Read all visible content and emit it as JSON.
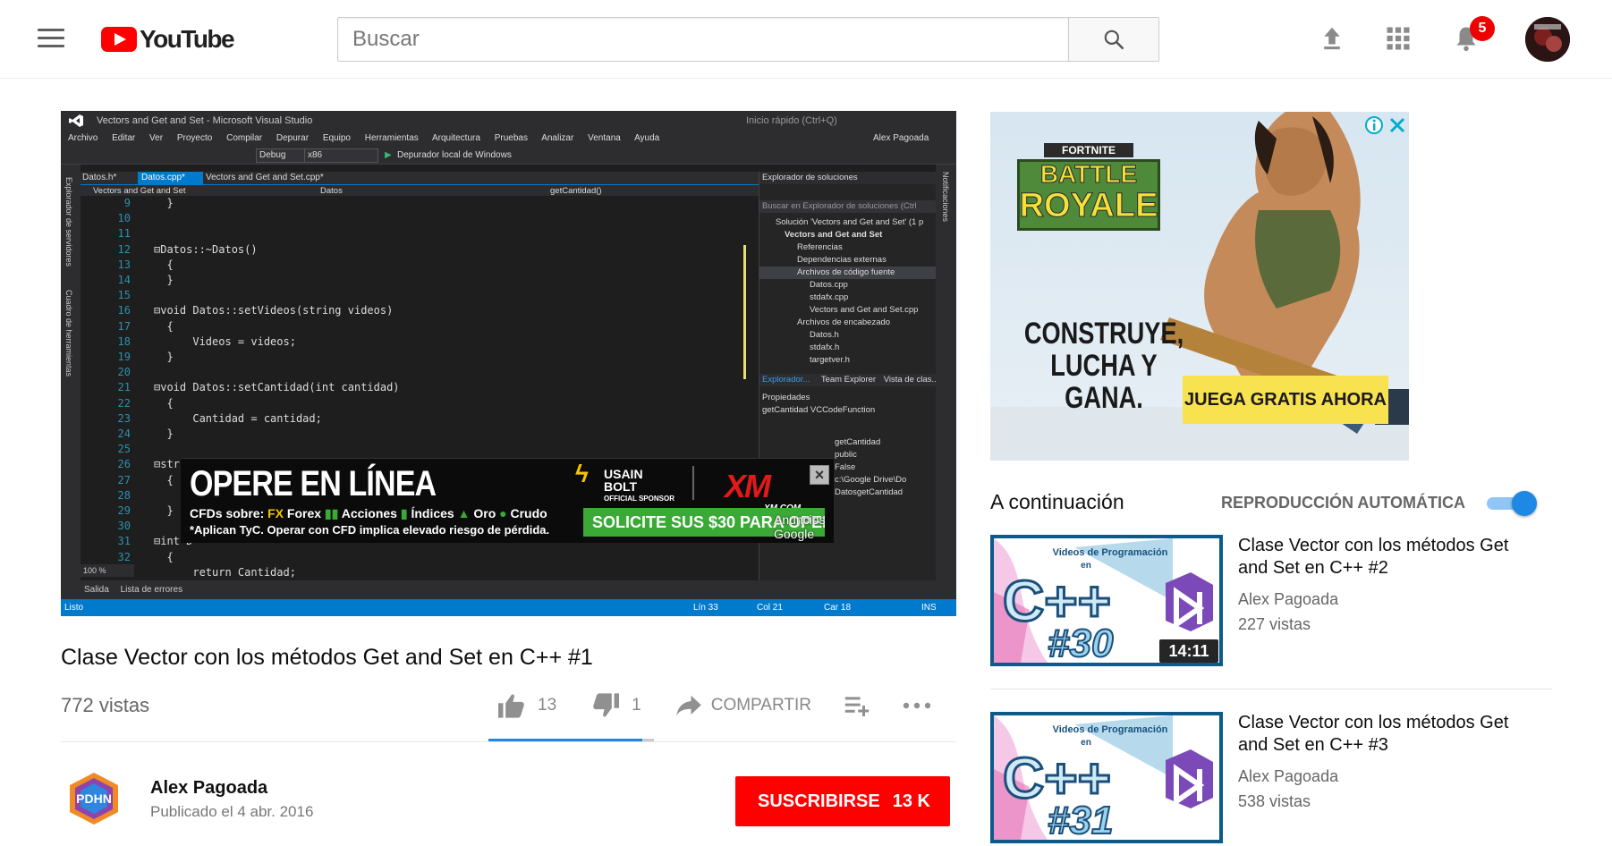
{
  "header": {
    "logo_text": "YouTube",
    "search_placeholder": "Buscar",
    "notification_count": "5"
  },
  "player": {
    "vs_title": "Vectors and Get and Set - Microsoft Visual Studio",
    "vs_menu": [
      "Archivo",
      "Editar",
      "Ver",
      "Proyecto",
      "Compilar",
      "Depurar",
      "Equipo",
      "Herramientas",
      "Arquitectura",
      "Pruebas",
      "Analizar",
      "Ventana",
      "Ayuda"
    ],
    "vs_user": "Alex Pagoada",
    "vs_quicklaunch": "Inicio rápido (Ctrl+Q)",
    "vs_config": "Debug",
    "vs_platform": "x86",
    "vs_debugger": "Depurador local de Windows",
    "vs_tabs": [
      "Datos.h*",
      "Datos.cpp*",
      "Vectors and Get and Set.cpp*"
    ],
    "vs_nav": [
      "Vectors and Get and Set",
      "Datos",
      "getCantidad()"
    ],
    "code_lines": [
      {
        "n": "9",
        "t": "  }"
      },
      {
        "n": "10",
        "t": ""
      },
      {
        "n": "11",
        "t": ""
      },
      {
        "n": "12",
        "t": "⊟Datos::~Datos()"
      },
      {
        "n": "13",
        "t": "  {"
      },
      {
        "n": "14",
        "t": "  }"
      },
      {
        "n": "15",
        "t": ""
      },
      {
        "n": "16",
        "t": "⊟void Datos::setVideos(string videos)"
      },
      {
        "n": "17",
        "t": "  {"
      },
      {
        "n": "18",
        "t": "      Videos = videos;"
      },
      {
        "n": "19",
        "t": "  }"
      },
      {
        "n": "20",
        "t": ""
      },
      {
        "n": "21",
        "t": "⊟void Datos::setCantidad(int cantidad)"
      },
      {
        "n": "22",
        "t": "  {"
      },
      {
        "n": "23",
        "t": "      Cantidad = cantidad;"
      },
      {
        "n": "24",
        "t": "  }"
      },
      {
        "n": "25",
        "t": ""
      },
      {
        "n": "26",
        "t": "⊟string Datos::getVideos()"
      },
      {
        "n": "27",
        "t": "  {"
      },
      {
        "n": "28",
        "t": "      r"
      },
      {
        "n": "29",
        "t": "  }"
      },
      {
        "n": "30",
        "t": ""
      },
      {
        "n": "31",
        "t": "⊟int D"
      },
      {
        "n": "32",
        "t": "  {"
      },
      {
        "n": "33",
        "t": "      return Cantidad;"
      }
    ],
    "vs_zoom": "100 %",
    "explorer_title": "Explorador de soluciones",
    "explorer_search": "Buscar en Explorador de soluciones (Ctrl",
    "explorer_items": [
      "Solución 'Vectors and Get and Set' (1 p",
      "Vectors and Get and Set",
      "Referencias",
      "Dependencias externas",
      "Archivos de código fuente",
      "Datos.cpp",
      "stdafx.cpp",
      "Vectors and Get and Set.cpp",
      "Archivos de encabezado",
      "Datos.h",
      "stdafx.h",
      "targetver.h"
    ],
    "explorer_tabs": [
      "Explorador...",
      "Team Explorer",
      "Vista de clas..."
    ],
    "props_title": "Propiedades",
    "props_object": "getCantidad  VCCodeFunction",
    "props_values": [
      "getCantidad",
      "public",
      "False",
      "c:\\Google Drive\\Do",
      "DatosgetCantidad"
    ],
    "vs_output_tabs": [
      "Salida",
      "Lista de errores"
    ],
    "vs_status": {
      "left": "Listo",
      "ln": "Lín 33",
      "col": "Col 21",
      "car": "Car 18",
      "mode": "INS"
    },
    "vs_side_labels": [
      "Explorador de servidores",
      "Cuadro de herramientas"
    ],
    "vs_right_label": "Notificaciones"
  },
  "overlay_ad": {
    "headline": "OPERE EN LÍNEA",
    "sub_prefix": "CFDs sobre:",
    "sub_items": [
      "FX",
      "Forex",
      "Acciones",
      "Índices",
      "Oro",
      "Crudo"
    ],
    "legal": "*Aplican TyC. Operar con CFD implica elevado riesgo de pérdida.",
    "bolt_line1": "USAIN",
    "bolt_line2": "BOLT",
    "bolt_line3": "OFFICIAL SPONSOR",
    "brand": "XM",
    "brand_url": "XM.COM",
    "cta": "SOLICITE SUS $30 PARA OPERAR",
    "google_label": "Anuncios Google"
  },
  "video": {
    "title": "Clase Vector con los métodos Get and Set en C++ #1",
    "views": "772 vistas",
    "likes": "13",
    "dislikes": "1",
    "share_label": "COMPARTIR",
    "like_ratio": 0.93
  },
  "channel": {
    "name": "Alex Pagoada",
    "published": "Publicado el 4 abr. 2016",
    "logo_text": "PDHN",
    "subscribe_label": "SUSCRIBIRSE",
    "subscriber_count": "13 K"
  },
  "side_ad": {
    "badge_line1": "FORTNITE",
    "badge_line2": "BATTLE",
    "badge_line3": "ROYALE",
    "tagline_line1": "CONSTRUYE,",
    "tagline_line2": "LUCHA Y",
    "tagline_line3": "GANA.",
    "cta": "JUEGA GRATIS AHORA"
  },
  "up_next": {
    "label": "A continuación",
    "autoplay_label": "REPRODUCCIÓN AUTOMÁTICA",
    "autoplay_on": true,
    "items": [
      {
        "title": "Clase Vector con los métodos Get and Set en C++ #2",
        "author": "Alex Pagoada",
        "views": "227 vistas",
        "duration": "14:11",
        "thumb_header": "Videos de Programación",
        "thumb_en": "en",
        "thumb_lang": "C++",
        "thumb_num": "#30"
      },
      {
        "title": "Clase Vector con los métodos Get and Set en C++ #3",
        "author": "Alex Pagoada",
        "views": "538 vistas",
        "duration": "",
        "thumb_header": "Videos de Programación",
        "thumb_en": "en",
        "thumb_lang": "C++",
        "thumb_num": "#31"
      }
    ]
  },
  "colors": {
    "brand_red": "#ff0000",
    "autoplay_blue": "#1e88e5",
    "vs_status_blue": "#007acc"
  }
}
